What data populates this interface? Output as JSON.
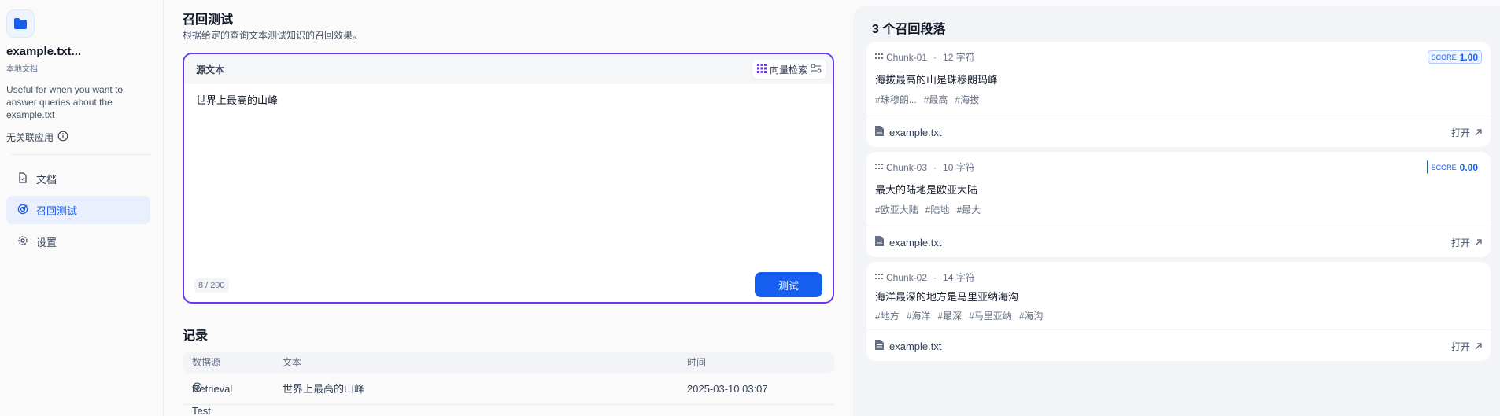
{
  "sidebar": {
    "dataset_name": "example.txt...",
    "dataset_type": "本地文档",
    "description": "Useful for when you want to answer queries about the example.txt",
    "related_apps": "无关联应用",
    "nav": [
      {
        "label": "文档",
        "icon": "document-icon",
        "active": false
      },
      {
        "label": "召回测试",
        "icon": "target-icon",
        "active": true
      },
      {
        "label": "设置",
        "icon": "gear-icon",
        "active": false
      }
    ]
  },
  "main": {
    "title": "召回测试",
    "subtitle": "根据给定的查询文本测试知识的召回效果。",
    "query": {
      "label": "源文本",
      "method_label": "向量检索",
      "text": "世界上最高的山峰",
      "count": "8",
      "max": "200",
      "button": "测试"
    },
    "records": {
      "title": "记录",
      "headers": [
        "数据源",
        "文本",
        "时间"
      ],
      "rows": [
        {
          "source": "Retrieval Test",
          "text": "世界上最高的山峰",
          "time": "2025-03-10 03:07"
        }
      ]
    }
  },
  "results": {
    "title": "3 个召回段落",
    "open_label": "打开",
    "score_label": "SCORE",
    "cards": [
      {
        "chunk": "Chunk-01",
        "chars": "12 字符",
        "score": "1.00",
        "text": "海拔最高的山是珠穆朗玛峰",
        "tags": [
          "珠穆朗...",
          "最高",
          "海拔"
        ],
        "file": "example.txt"
      },
      {
        "chunk": "Chunk-03",
        "chars": "10 字符",
        "score": "0.00",
        "text": "最大的陆地是欧亚大陆",
        "tags": [
          "欧亚大陆",
          "陆地",
          "最大"
        ],
        "file": "example.txt"
      },
      {
        "chunk": "Chunk-02",
        "chars": "14 字符",
        "score": "",
        "text": "海洋最深的地方是马里亚纳海沟",
        "tags": [
          "地方",
          "海洋",
          "最深",
          "马里亚纳",
          "海沟"
        ],
        "file": "example.txt"
      }
    ]
  },
  "colors": {
    "accent": "#155eef",
    "border_active": "#6938ef"
  }
}
